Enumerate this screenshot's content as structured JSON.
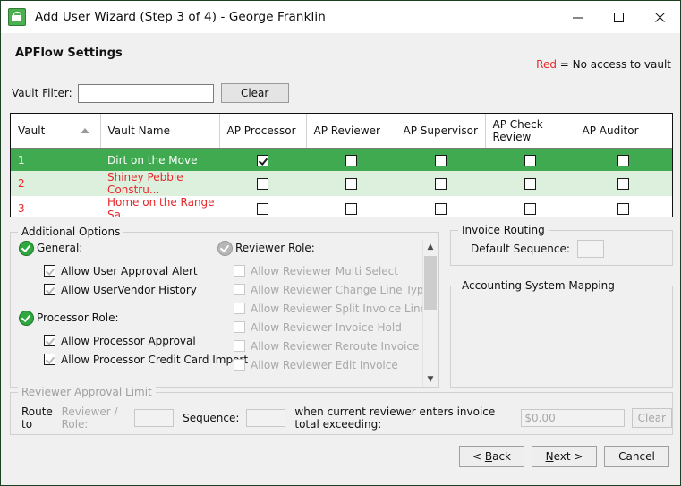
{
  "window": {
    "title": "Add User Wizard (Step 3 of 4) - George Franklin",
    "icon": "lock-icon",
    "controls": {
      "minimize": "minimize-icon",
      "maximize": "maximize-icon",
      "close": "close-icon"
    }
  },
  "header": {
    "page_title": "APFlow Settings",
    "legend_key": "Red",
    "legend_text": "= No access to vault",
    "legend_color": "#e8262a"
  },
  "filter": {
    "label": "Vault Filter:",
    "value": "",
    "placeholder": "",
    "clear_label": "Clear"
  },
  "grid": {
    "columns": [
      {
        "label": "Vault",
        "sorted": true,
        "sort_dir": "asc"
      },
      {
        "label": "Vault Name",
        "sorted": false
      },
      {
        "label": "AP Processor",
        "sorted": false
      },
      {
        "label": "AP Reviewer",
        "sorted": false
      },
      {
        "label": "AP Supervisor",
        "sorted": false
      },
      {
        "label": "AP Check Review",
        "sorted": false
      },
      {
        "label": "AP Auditor",
        "sorted": false
      }
    ],
    "rows": [
      {
        "vault": "1",
        "vault_name": "Dirt on the Move",
        "state": "selected",
        "ap_processor": true,
        "ap_reviewer": false,
        "ap_supervisor": false,
        "ap_check_review": false,
        "ap_auditor": false
      },
      {
        "vault": "2",
        "vault_name": "Shiney Pebble Constru...",
        "state": "no-access-alt",
        "ap_processor": false,
        "ap_reviewer": false,
        "ap_supervisor": false,
        "ap_check_review": false,
        "ap_auditor": false
      },
      {
        "vault": "3",
        "vault_name": "Home on the Range Sa...",
        "state": "no-access",
        "ap_processor": false,
        "ap_reviewer": false,
        "ap_supervisor": false,
        "ap_check_review": false,
        "ap_auditor": false
      }
    ],
    "selected_row_color": "#3faa4f",
    "alt_row_color": "#ddf0dd",
    "no_access_text_color": "#e8262a"
  },
  "additional_options": {
    "caption": "Additional Options",
    "sections": [
      {
        "name": "general",
        "label": "General:",
        "enabled": true,
        "items": [
          {
            "label": "Allow User Approval Alert",
            "checked": true,
            "enabled": true
          },
          {
            "label": "Allow UserVendor History",
            "checked": true,
            "enabled": true
          }
        ]
      },
      {
        "name": "processor-role",
        "label": "Processor Role:",
        "enabled": true,
        "items": [
          {
            "label": "Allow Processor Approval",
            "checked": true,
            "enabled": true
          },
          {
            "label": "Allow Processor Credit Card Import",
            "checked": true,
            "enabled": true
          }
        ]
      },
      {
        "name": "reviewer-role",
        "label": "Reviewer Role:",
        "enabled": false,
        "items": [
          {
            "label": "Allow Reviewer Multi Select",
            "checked": false,
            "enabled": false
          },
          {
            "label": "Allow Reviewer Change Line Type",
            "checked": false,
            "enabled": false
          },
          {
            "label": "Allow Reviewer Split Invoice Lines",
            "checked": false,
            "enabled": false
          },
          {
            "label": "Allow Reviewer Invoice Hold",
            "checked": false,
            "enabled": false
          },
          {
            "label": "Allow Reviewer Reroute Invoice",
            "checked": false,
            "enabled": false
          },
          {
            "label": "Allow Reviewer Edit Invoice",
            "checked": false,
            "enabled": false
          }
        ]
      }
    ]
  },
  "invoice_routing": {
    "caption": "Invoice Routing",
    "default_sequence_label": "Default Sequence:",
    "default_sequence_value": ""
  },
  "accounting_system_mapping": {
    "caption": "Accounting System Mapping"
  },
  "reviewer_approval_limit": {
    "caption": "Reviewer Approval Limit",
    "route_to_label": "Route to",
    "reviewer_role_label": "Reviewer / Role:",
    "reviewer_role_value": "",
    "sequence_label": "Sequence:",
    "sequence_value": "",
    "condition_text": "when current reviewer enters invoice total exceeding:",
    "amount_value": "$0.00",
    "clear_label": "Clear"
  },
  "footer": {
    "back_label": "< Back",
    "next_label": "Next >",
    "cancel_label": "Cancel"
  }
}
